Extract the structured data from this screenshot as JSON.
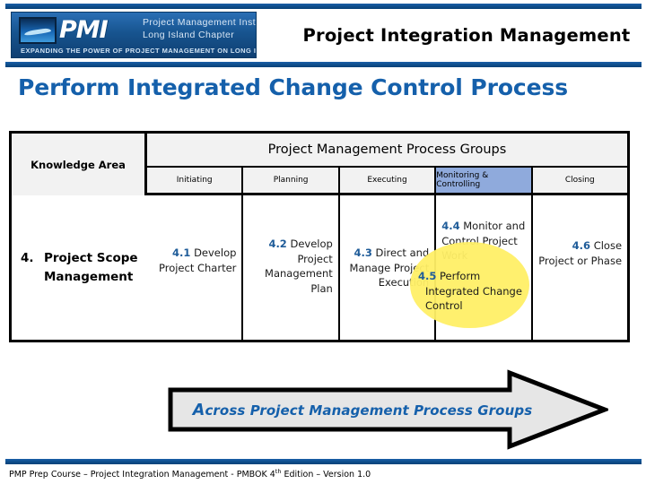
{
  "header": {
    "title": "Project Integration Management",
    "logo": {
      "letters": "PMI",
      "org_line1": "Project Management Institute",
      "org_line2": "Long Island Chapter",
      "tagline": "EXPANDING THE POWER OF PROJECT MANAGEMENT ON LONG ISLAND"
    }
  },
  "slide": {
    "title": "Perform Integrated Change Control Process"
  },
  "matrix": {
    "knowledge_area_header": "Knowledge Area",
    "process_groups_header": "Project Management Process Groups",
    "group_columns": [
      {
        "label": "Initiating",
        "highlight": false
      },
      {
        "label": "Planning",
        "highlight": false
      },
      {
        "label": "Executing",
        "highlight": false
      },
      {
        "label": "Monitoring & Controlling",
        "highlight": true
      },
      {
        "label": "Closing",
        "highlight": false
      }
    ],
    "row": {
      "knowledge_area_number": "4.",
      "knowledge_area_name": "Project Scope Management",
      "initiating": {
        "number": "4.1",
        "text": "Develop Project Charter"
      },
      "planning": {
        "number": "4.2",
        "text": "Develop Project Management Plan"
      },
      "executing": {
        "number": "4.3",
        "text": "Direct and Manage Project Execution"
      },
      "monitoring_controlling_1": {
        "number": "4.4",
        "text": "Monitor and Control Project Work"
      },
      "monitoring_controlling_2": {
        "number": "4.5",
        "text": "Perform Integrated Change Control"
      },
      "closing": {
        "number": "4.6",
        "text": "Close Project or Phase"
      }
    }
  },
  "arrow": {
    "lead_cap": "A",
    "text_rest": "cross Project Management Process Groups"
  },
  "footer": {
    "text_before_sup": "PMP Prep Course – Project Integration Management - PMBOK 4",
    "sup": "th",
    "text_after_sup": " Edition – Version 1.0"
  },
  "colors": {
    "brand_blue": "#0d4c88",
    "title_blue": "#1560ab",
    "number_blue": "#1f5c99",
    "highlight_cell": "#8faadc",
    "highlight_ellipse": "#ffef66",
    "arrow_fill": "#e6e6e6"
  }
}
